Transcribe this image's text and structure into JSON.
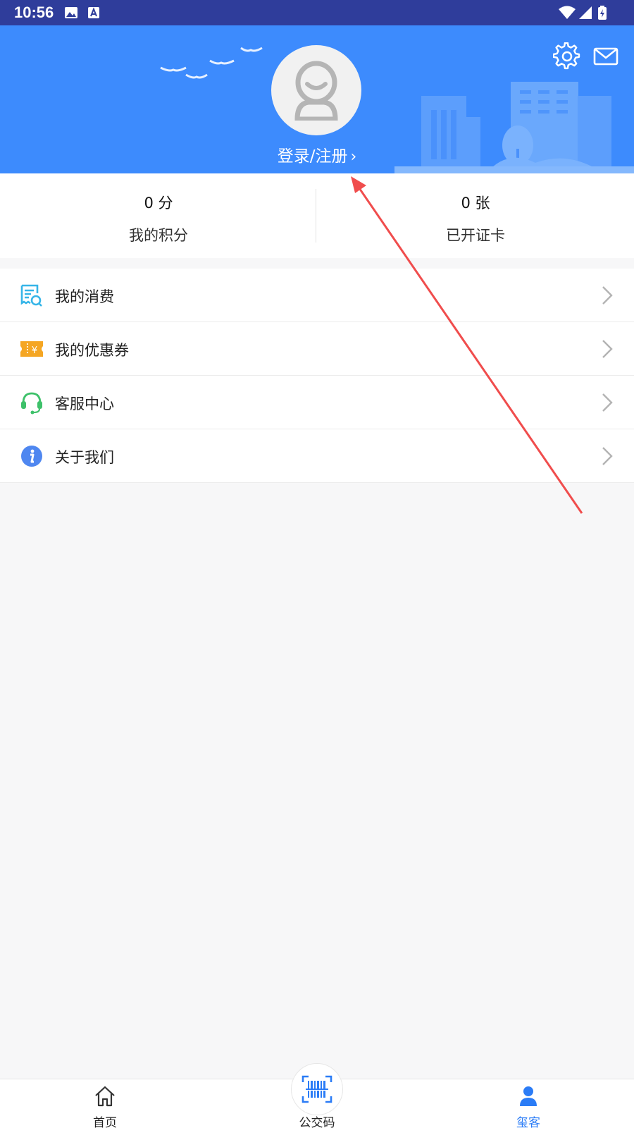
{
  "status_bar": {
    "time": "10:56",
    "background_color": "#2f3d9b"
  },
  "header": {
    "background_color": "#3d8bfd",
    "login_label": "登录/注册",
    "icons": [
      "settings-icon",
      "mail-icon"
    ]
  },
  "stats": [
    {
      "value": "0 分",
      "label": "我的积分"
    },
    {
      "value": "0 张",
      "label": "已开证卡"
    }
  ],
  "menu": [
    {
      "label": "我的消费",
      "icon": "receipt-icon",
      "color": "#36b5e8"
    },
    {
      "label": "我的优惠券",
      "icon": "coupon-icon",
      "color": "#f5a623"
    },
    {
      "label": "客服中心",
      "icon": "headset-icon",
      "color": "#3ec16a"
    },
    {
      "label": "关于我们",
      "icon": "info-icon",
      "color": "#4f87f0"
    }
  ],
  "tabbar": {
    "tabs": [
      {
        "label": "首页",
        "icon": "home-icon",
        "active": false
      },
      {
        "label": "公交码",
        "icon": "barcode-scan-icon",
        "active": false
      },
      {
        "label": "玺客",
        "icon": "person-icon",
        "active": true
      }
    ],
    "active_color": "#2b7cf6"
  },
  "annotation": {
    "type": "arrow",
    "color": "#f04d4d"
  }
}
